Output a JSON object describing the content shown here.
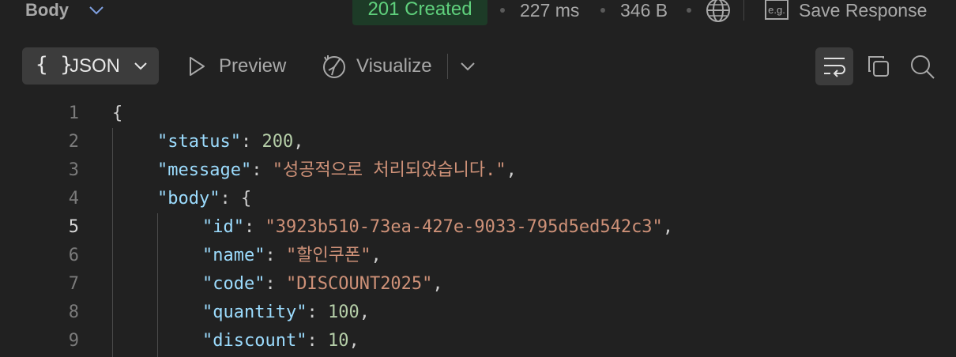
{
  "header": {
    "body_label": "Body",
    "status": "201 Created",
    "time": "227 ms",
    "size": "346 B",
    "eg_label": "e.g.",
    "save_response": "Save Response"
  },
  "toolbar": {
    "format": "JSON",
    "format_braces": "{ }",
    "preview": "Preview",
    "visualize": "Visualize"
  },
  "code": {
    "line_numbers": [
      "1",
      "2",
      "3",
      "4",
      "5",
      "6",
      "7",
      "8",
      "9"
    ],
    "active_line": "5",
    "lines": [
      {
        "indent": 0,
        "punct": "{"
      },
      {
        "indent": 1,
        "key": "\"status\"",
        "value": "200",
        "vtype": "n",
        "tail": ","
      },
      {
        "indent": 1,
        "key": "\"message\"",
        "value": "\"성공적으로 처리되었습니다.\"",
        "vtype": "s",
        "tail": ","
      },
      {
        "indent": 1,
        "key": "\"body\"",
        "value": "{",
        "vtype": "p",
        "tail": ""
      },
      {
        "indent": 2,
        "key": "\"id\"",
        "value": "\"3923b510-73ea-427e-9033-795d5ed542c3\"",
        "vtype": "s",
        "tail": ","
      },
      {
        "indent": 2,
        "key": "\"name\"",
        "value": "\"할인쿠폰\"",
        "vtype": "s",
        "tail": ","
      },
      {
        "indent": 2,
        "key": "\"code\"",
        "value": "\"DISCOUNT2025\"",
        "vtype": "s",
        "tail": ","
      },
      {
        "indent": 2,
        "key": "\"quantity\"",
        "value": "100",
        "vtype": "n",
        "tail": ","
      },
      {
        "indent": 2,
        "key": "\"discount\"",
        "value": "10",
        "vtype": "n",
        "tail": ","
      }
    ]
  },
  "colors": {
    "background": "#212121",
    "status_bg": "#1d3b27",
    "status_fg": "#5fd07c",
    "json_key": "#9cdcfe",
    "json_string": "#ce9178",
    "json_number": "#b5cea8"
  }
}
